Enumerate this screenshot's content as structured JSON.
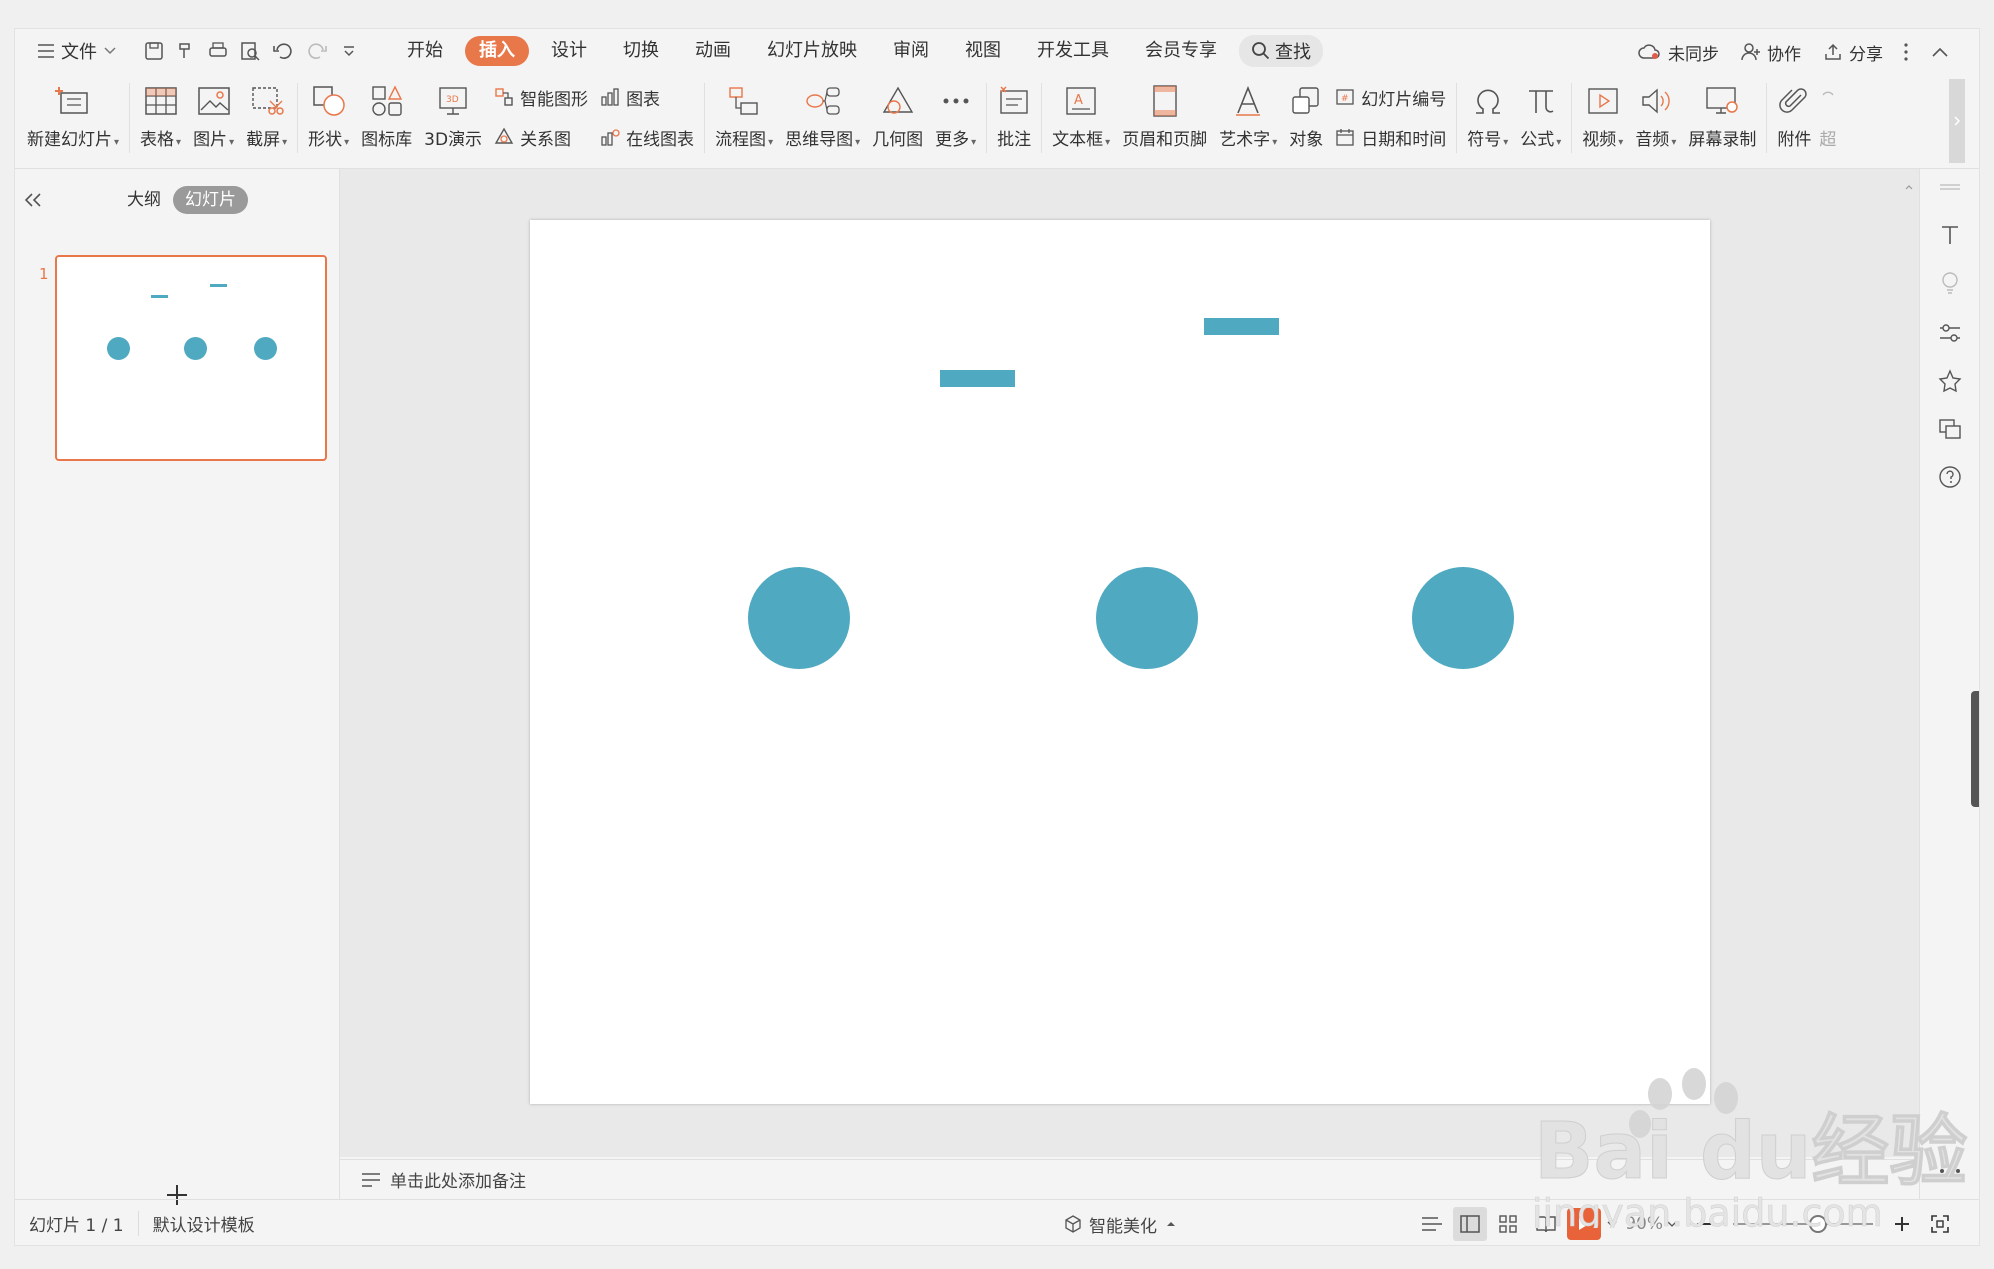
{
  "menu": {
    "file_label": "文件",
    "tabs": [
      {
        "label": "开始",
        "active": false
      },
      {
        "label": "插入",
        "active": true
      },
      {
        "label": "设计",
        "active": false
      },
      {
        "label": "切换",
        "active": false
      },
      {
        "label": "动画",
        "active": false
      },
      {
        "label": "幻灯片放映",
        "active": false
      },
      {
        "label": "审阅",
        "active": false
      },
      {
        "label": "视图",
        "active": false
      },
      {
        "label": "开发工具",
        "active": false
      },
      {
        "label": "会员专享",
        "active": false
      }
    ],
    "search_label": "查找",
    "sync_label": "未同步",
    "collab_label": "协作",
    "share_label": "分享"
  },
  "ribbon": {
    "new_slide": "新建幻灯片",
    "table": "表格",
    "picture": "图片",
    "screenshot": "截屏",
    "shape": "形状",
    "icon_lib": "图标库",
    "demo3d": "3D演示",
    "smart_shape": "智能图形",
    "chart": "图表",
    "relation": "关系图",
    "online_chart": "在线图表",
    "flowchart": "流程图",
    "mindmap": "思维导图",
    "geometry": "几何图",
    "more": "更多",
    "comment": "批注",
    "textbox": "文本框",
    "header_footer": "页眉和页脚",
    "wordart": "艺术字",
    "object": "对象",
    "slide_number": "幻灯片编号",
    "datetime": "日期和时间",
    "symbol": "符号",
    "formula": "公式",
    "video": "视频",
    "audio": "音频",
    "screen_record": "屏幕录制",
    "attachment": "附件",
    "overflow": "超"
  },
  "left_pane": {
    "outline_tab": "大纲",
    "slides_tab": "幻灯片",
    "slide_number": "1"
  },
  "notes_placeholder": "单击此处添加备注",
  "status": {
    "slide_info": "幻灯片 1 / 1",
    "template": "默认设计模板",
    "beautify": "智能美化",
    "zoom": "90%"
  },
  "colors": {
    "accent": "#e8774a",
    "shape": "#4fa9c1"
  },
  "watermark": {
    "brand": "Baidu经验",
    "url": "jingyan.baidu.com"
  }
}
